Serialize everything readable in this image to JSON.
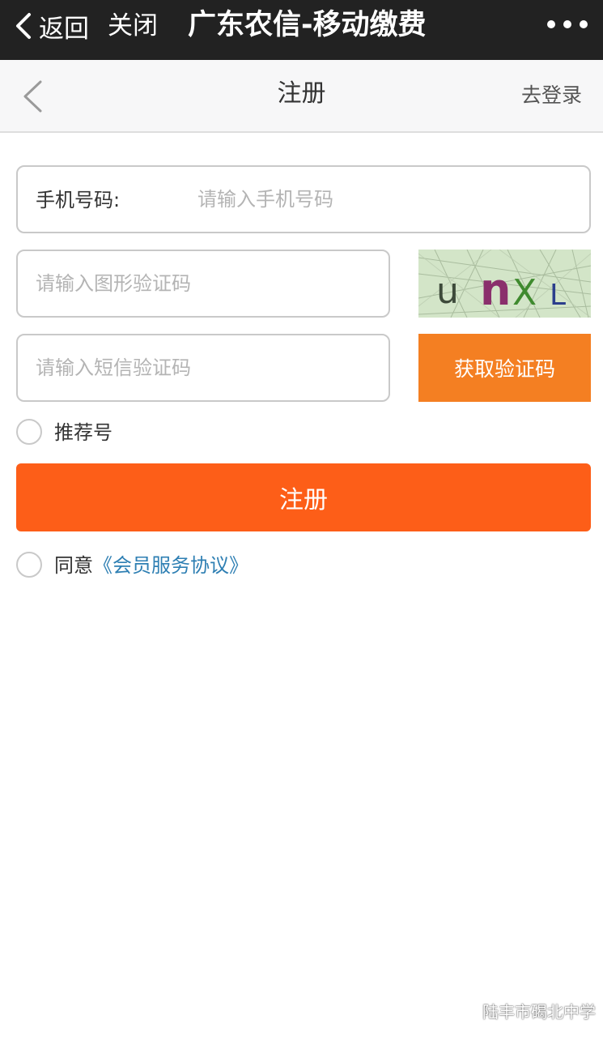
{
  "topbar": {
    "back_label": "返回",
    "close_label": "关闭",
    "title": "广东农信-移动缴费"
  },
  "nav": {
    "title": "注册",
    "login_link": "去登录"
  },
  "form": {
    "phone_label": "手机号码:",
    "phone_placeholder": "请输入手机号码",
    "captcha_placeholder": "请输入图形验证码",
    "captcha_text": "unXL",
    "sms_placeholder": "请输入短信验证码",
    "sms_button": "获取验证码",
    "referral_label": "推荐号",
    "register_button": "注册",
    "agree_prefix": "同意",
    "agreement_link": "《会员服务协议》"
  },
  "watermark": {
    "text": "陆丰市碣北中学"
  },
  "colors": {
    "topbar_bg": "#222222",
    "navbar_bg": "#f7f7f8",
    "sms_button": "#f47f22",
    "register_button": "#fd5e18",
    "link": "#2e7fb3"
  }
}
